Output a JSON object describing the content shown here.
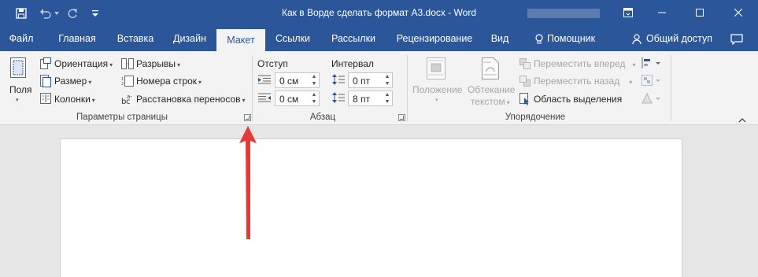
{
  "window": {
    "title": "Как в Ворде сделать формат А3.docx - Word"
  },
  "tabs": [
    {
      "label": "Файл"
    },
    {
      "label": "Главная"
    },
    {
      "label": "Вставка"
    },
    {
      "label": "Дизайн"
    },
    {
      "label": "Макет"
    },
    {
      "label": "Ссылки"
    },
    {
      "label": "Рассылки"
    },
    {
      "label": "Рецензирование"
    },
    {
      "label": "Вид"
    }
  ],
  "tell_me": {
    "label": "Помощник"
  },
  "share": {
    "label": "Общий доступ"
  },
  "page_setup": {
    "fields": "Поля",
    "orientation": "Ориентация",
    "size": "Размер",
    "columns": "Колонки",
    "breaks": "Разрывы",
    "line_numbers": "Номера строк",
    "hyphenation": "Расстановка переносов",
    "group_label": "Параметры страницы"
  },
  "paragraph": {
    "indent_label": "Отступ",
    "spacing_label": "Интервал",
    "indent_left": "0 см",
    "indent_right": "0 см",
    "spacing_before": "0 пт",
    "spacing_after": "8 пт",
    "group_label": "Абзац"
  },
  "arrange": {
    "position": "Положение",
    "wrap_line1": "Обтекание",
    "wrap_line2": "текстом",
    "bring_forward": "Переместить вперед",
    "send_backward": "Переместить назад",
    "selection_pane": "Область выделения",
    "group_label": "Упорядочение"
  },
  "colors": {
    "word_blue": "#2b579a",
    "ribbon_bg": "#f3f3f3",
    "arrow_red": "#e53935"
  }
}
